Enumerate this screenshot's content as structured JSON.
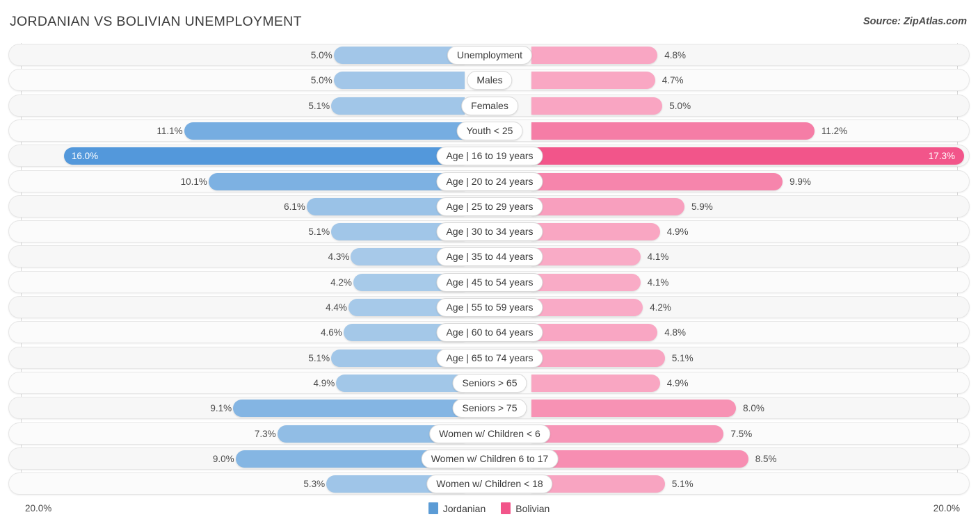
{
  "header": {
    "title": "JORDANIAN VS BOLIVIAN UNEMPLOYMENT",
    "source": "Source: ZipAtlas.com"
  },
  "axis": {
    "left_max_label": "20.0%",
    "right_max_label": "20.0%"
  },
  "legend": {
    "items": [
      {
        "label": "Jordanian",
        "color": "#5b9bd5"
      },
      {
        "label": "Bolivian",
        "color": "#f2558a"
      }
    ]
  },
  "colors": {
    "left_min": "#a8cae9",
    "left_max": "#4a93d9",
    "right_min": "#f9abc6",
    "right_max": "#f2558a",
    "track": "#f7f7f7",
    "gridline": "#d8d8d8"
  },
  "chart_data": {
    "type": "bar",
    "orientation": "horizontal-diverging",
    "title": "JORDANIAN VS BOLIVIAN UNEMPLOYMENT",
    "xlabel": "",
    "ylabel": "",
    "xlim": [
      20.0,
      20.0
    ],
    "axis_max": 20.0,
    "unit": "%",
    "grid": true,
    "legend_position": "bottom-center",
    "categories": [
      "Unemployment",
      "Males",
      "Females",
      "Youth < 25",
      "Age | 16 to 19 years",
      "Age | 20 to 24 years",
      "Age | 25 to 29 years",
      "Age | 30 to 34 years",
      "Age | 35 to 44 years",
      "Age | 45 to 54 years",
      "Age | 55 to 59 years",
      "Age | 60 to 64 years",
      "Age | 65 to 74 years",
      "Seniors > 65",
      "Seniors > 75",
      "Women w/ Children < 6",
      "Women w/ Children 6 to 17",
      "Women w/ Children < 18"
    ],
    "series": [
      {
        "name": "Jordanian",
        "side": "left",
        "values": [
          5.0,
          5.0,
          5.1,
          11.1,
          16.0,
          10.1,
          6.1,
          5.1,
          4.3,
          4.2,
          4.4,
          4.6,
          5.1,
          4.9,
          9.1,
          7.3,
          9.0,
          5.3
        ],
        "labels": [
          "5.0%",
          "5.0%",
          "5.1%",
          "11.1%",
          "16.0%",
          "10.1%",
          "6.1%",
          "5.1%",
          "4.3%",
          "4.2%",
          "4.4%",
          "4.6%",
          "5.1%",
          "4.9%",
          "9.1%",
          "7.3%",
          "9.0%",
          "5.3%"
        ]
      },
      {
        "name": "Bolivian",
        "side": "right",
        "values": [
          4.8,
          4.7,
          5.0,
          11.2,
          17.3,
          9.9,
          5.9,
          4.9,
          4.1,
          4.1,
          4.2,
          4.8,
          5.1,
          4.9,
          8.0,
          7.5,
          8.5,
          5.1
        ],
        "labels": [
          "4.8%",
          "4.7%",
          "5.0%",
          "11.2%",
          "17.3%",
          "9.9%",
          "5.9%",
          "4.9%",
          "4.1%",
          "4.1%",
          "4.2%",
          "4.8%",
          "5.1%",
          "4.9%",
          "8.0%",
          "7.5%",
          "8.5%",
          "5.1%"
        ]
      }
    ]
  }
}
